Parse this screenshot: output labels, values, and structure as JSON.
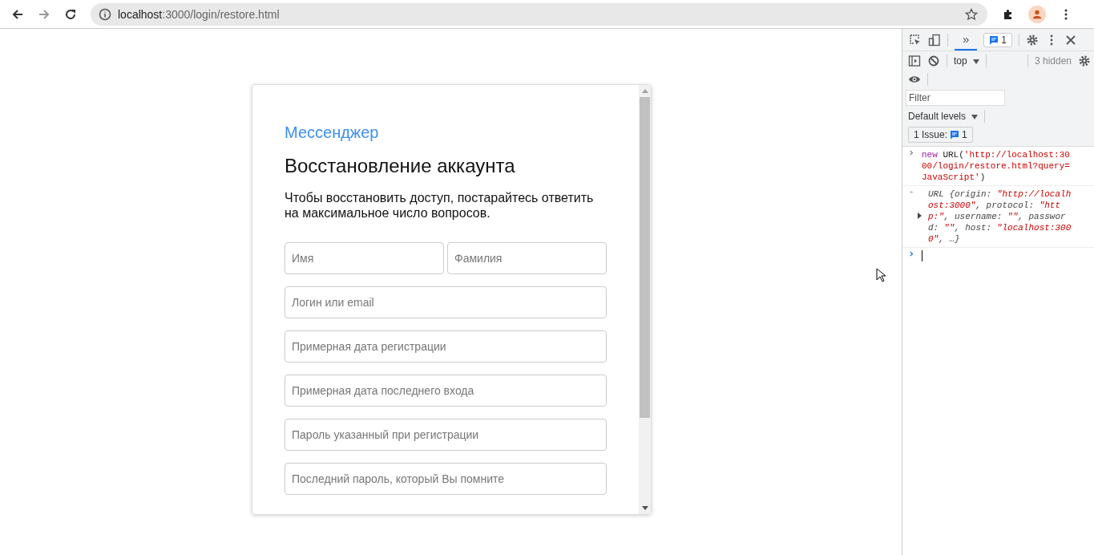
{
  "browser": {
    "url_host": "localhost",
    "url_rest": ":3000/login/restore.html"
  },
  "card": {
    "brand": "Мессенджер",
    "title": "Восстановление аккаунта",
    "description": "Чтобы восстановить доступ, постарайтесь ответить на максимальное число вопросов.",
    "field_rows": [
      [
        {
          "placeholder": "Имя"
        },
        {
          "placeholder": "Фамилия"
        }
      ],
      [
        {
          "placeholder": "Логин или email"
        }
      ],
      [
        {
          "placeholder": "Примерная дата регистрации"
        }
      ],
      [
        {
          "placeholder": "Примерная дата последнего входа"
        }
      ],
      [
        {
          "placeholder": "Пароль указанный при регистрации"
        }
      ],
      [
        {
          "placeholder": "Последний пароль, который Вы помните"
        }
      ]
    ]
  },
  "devtools": {
    "tabs": [
      {
        "label": "»",
        "selected": true
      }
    ],
    "issues_badge": "1",
    "context": "top",
    "hidden": "3 hidden",
    "filter_placeholder": "Filter",
    "levels": "Default levels",
    "issues_label": "1 Issue:",
    "issues_count": "1",
    "entries": [
      {
        "kind": "input",
        "parts": [
          {
            "text": "new",
            "kind": "keyword"
          },
          {
            "text": " URL(",
            "kind": "plain"
          },
          {
            "text": "'http://localhost:3000/login/restore.html?query=JavaScript'",
            "kind": "string"
          },
          {
            "text": ")",
            "kind": "plain"
          }
        ]
      },
      {
        "kind": "output",
        "parts": [
          {
            "text": "URL {origin: ",
            "kind": "plain"
          },
          {
            "text": "\"http://localhost:3000\"",
            "kind": "string"
          },
          {
            "text": ", protocol: ",
            "kind": "plain"
          },
          {
            "text": "\"http:\"",
            "kind": "string"
          },
          {
            "text": ", username: ",
            "kind": "plain"
          },
          {
            "text": "\"\"",
            "kind": "string"
          },
          {
            "text": ", password: ",
            "kind": "plain"
          },
          {
            "text": "\"\"",
            "kind": "string"
          },
          {
            "text": ", host: ",
            "kind": "plain"
          },
          {
            "text": "\"localhost:3000\"",
            "kind": "string"
          },
          {
            "text": ", …}",
            "kind": "plain"
          }
        ]
      }
    ]
  }
}
